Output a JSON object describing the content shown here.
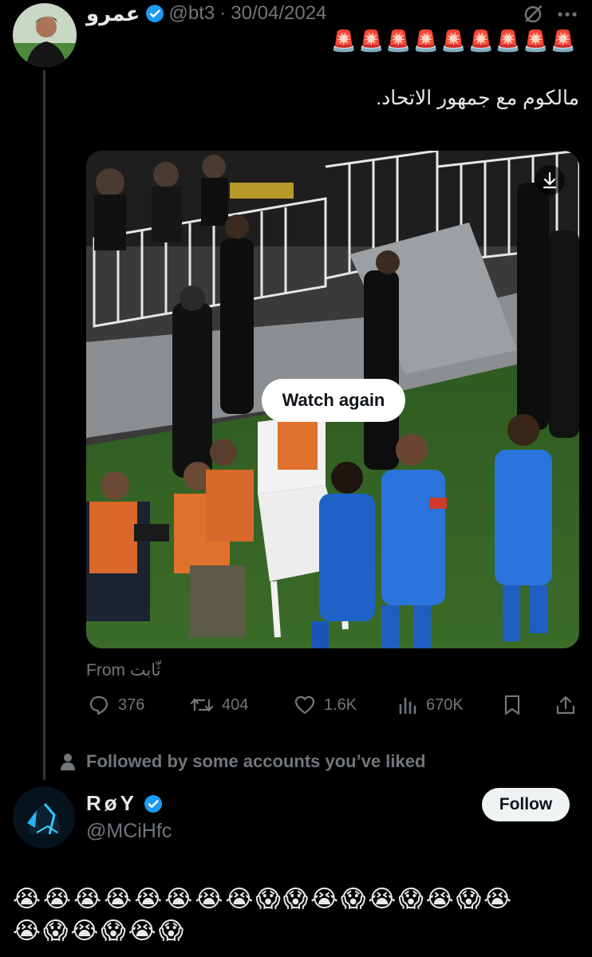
{
  "tweet": {
    "author_name": "عمرو",
    "handle": "@bt3",
    "date": "30/04/2024",
    "sep": "·",
    "siren_line": "🚨🚨🚨🚨🚨🚨🚨🚨🚨",
    "text": "مالكوم مع جمهور الاتحاد.",
    "watch_again": "Watch again",
    "from_label": "From ثّابت",
    "replies": "376",
    "retweets": "404",
    "likes": "1.6K",
    "views": "670K"
  },
  "social_context": "Followed by some accounts you’ve liked",
  "user": {
    "name": "RøY",
    "handle": "@MCiHfc",
    "follow_label": "Follow"
  },
  "reply": {
    "line1": "😭😭😭😭😭😭😭😭😱😱😭😱😭😱😭😱😭",
    "line2": "😭😱😭😱😭😱"
  },
  "colors": {
    "background": "#000000",
    "verified": "#1d9bf0",
    "muted": "#71767b",
    "text": "#e7e9ea"
  }
}
